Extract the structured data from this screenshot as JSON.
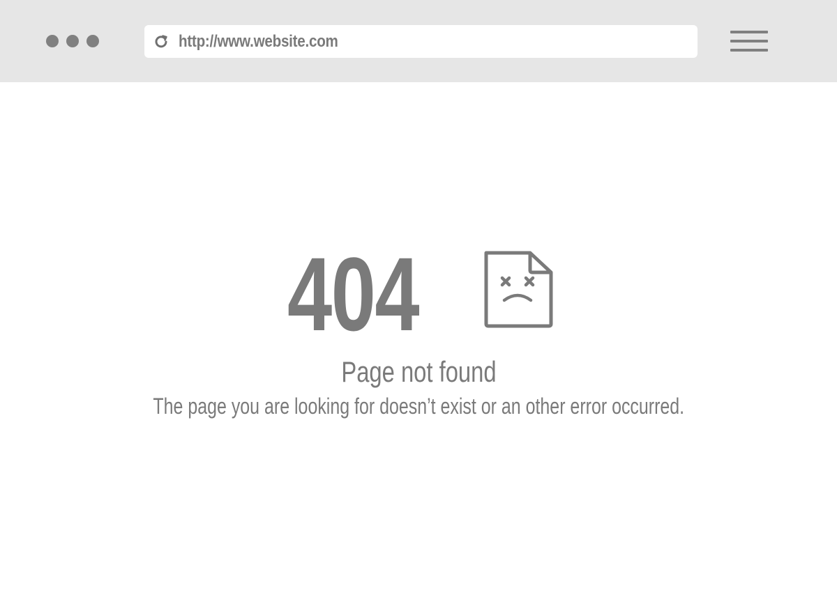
{
  "browser": {
    "url": "http://www.website.com",
    "window_controls": [
      "dot",
      "dot",
      "dot"
    ],
    "menu_icon": "hamburger-menu-icon",
    "reload_icon": "reload-icon"
  },
  "error": {
    "code": "404",
    "icon": "broken-file-icon",
    "title": "Page not found",
    "message": "The page you are looking for doesn’t exist or an other error occurred."
  },
  "colors": {
    "toolbar_bg": "#e6e6e6",
    "address_bar_bg": "#ffffff",
    "icon_gray": "#808080",
    "text_gray": "#7a7a7a",
    "page_bg": "#ffffff"
  }
}
